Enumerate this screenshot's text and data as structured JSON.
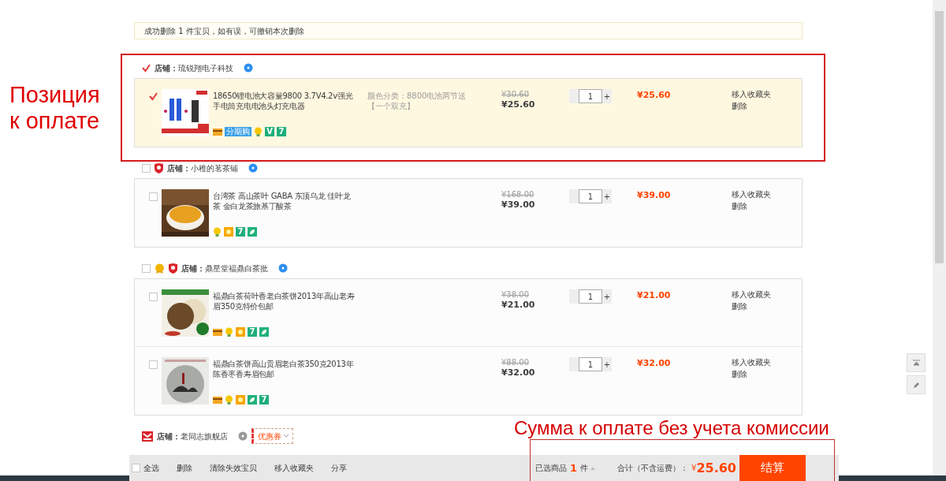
{
  "notice": "成功删除 1 件宝贝，如有误，可撤销本次删除",
  "shops": [
    {
      "checked": true,
      "label": "店铺：",
      "name": "琉锐翔电子科技",
      "online": true,
      "items": [
        {
          "checked": true,
          "image": {
            "kind": "picture"
          },
          "title": "18650锂电池大容量9800 3.7V4.2v强光手电筒充电电池头灯充电器",
          "sku": "颜色分类：8800电池两节送【一个双充】",
          "services": [
            {
              "kind": "card"
            },
            {
              "kind": "label",
              "label": "分期购"
            },
            {
              "kind": "bulb"
            },
            {
              "kind": "letter",
              "label": "V"
            },
            {
              "kind": "letter",
              "label": "7"
            }
          ],
          "original_price": "¥30.60",
          "price": "¥25.60",
          "quantity": "1",
          "increase": "+",
          "total": "¥25.60",
          "actions": [
            "移入收藏夹",
            "删除"
          ]
        }
      ]
    },
    {
      "checked": false,
      "badges": [
        {
          "kind": "shield"
        }
      ],
      "label": "店铺：",
      "name": "小稚的茗茶铺",
      "online": true,
      "items": [
        {
          "checked": false,
          "image": {
            "kind": "picture"
          },
          "title": "台湾茶 高山茶叶 GABA 东顶乌龙 佳叶龙茶 金白龙茶旅基丁酸茶",
          "services": [
            {
              "kind": "bulb"
            },
            {
              "kind": "sun"
            },
            {
              "kind": "letter",
              "label": "7"
            },
            {
              "kind": "leaf"
            }
          ],
          "original_price": "¥168.00",
          "price": "¥39.00",
          "quantity": "1",
          "increase": "+",
          "total": "¥39.00",
          "actions": [
            "移入收藏夹",
            "删除"
          ]
        }
      ]
    },
    {
      "checked": false,
      "badges": [
        {
          "kind": "medal"
        },
        {
          "kind": "shield"
        }
      ],
      "label": "店铺：",
      "name": "鼎星堂福鼎白茶批",
      "online": true,
      "items": [
        {
          "checked": false,
          "image": {
            "kind": "picture"
          },
          "title": "福鼎白茶荷叶香老白茶饼2013年高山老寿眉350克特价包邮",
          "services": [
            {
              "kind": "card"
            },
            {
              "kind": "bulb"
            },
            {
              "kind": "sun"
            },
            {
              "kind": "letter",
              "label": "7"
            },
            {
              "kind": "leaf"
            }
          ],
          "original_price": "¥38.00",
          "price": "¥21.00",
          "quantity": "1",
          "increase": "+",
          "total": "¥21.00",
          "actions": [
            "移入收藏夹",
            "删除"
          ]
        },
        {
          "checked": false,
          "image": {
            "kind": "picture"
          },
          "title": "福鼎白茶饼高山贡眉老白茶350克2013年陈香枣香寿眉包邮",
          "services": [
            {
              "kind": "card"
            },
            {
              "kind": "bulb"
            },
            {
              "kind": "sun"
            },
            {
              "kind": "leaf"
            },
            {
              "kind": "letter",
              "label": "7"
            }
          ],
          "original_price": "¥88.00",
          "price": "¥32.00",
          "quantity": "1",
          "increase": "+",
          "total": "¥32.00",
          "actions": [
            "移入收藏夹",
            "删除"
          ]
        }
      ]
    },
    {
      "badges": [
        {
          "kind": "store"
        }
      ],
      "label": "店铺：",
      "name": "老同志旗舰店",
      "online": false,
      "coupon": "优惠券"
    }
  ],
  "footer": {
    "select_all": {
      "label": "全选",
      "checked": false
    },
    "links": [
      "删除",
      "清除失效宝贝",
      "移入收藏夹",
      "分享"
    ],
    "selected_label": "已选商品",
    "selected_count": "1",
    "selected_unit": "件",
    "total_label": "合计（不含运费）：",
    "currency": "¥",
    "total": "25.60",
    "checkout": "结算"
  },
  "annotations": [
    {
      "text": "Позиция к оплате"
    },
    {
      "text": "Сумма к оплате без учета комиссии"
    }
  ]
}
